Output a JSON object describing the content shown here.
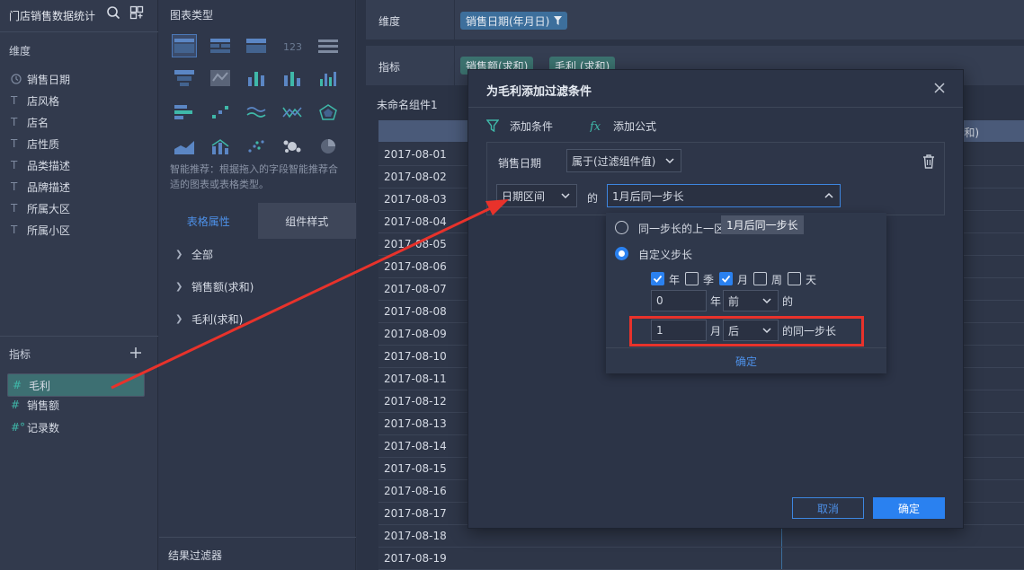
{
  "fields_panel": {
    "title": "门店销售数据统计",
    "dimensions_label": "维度",
    "dimensions": [
      {
        "type": "date",
        "label": "销售日期"
      },
      {
        "type": "T",
        "label": "店风格"
      },
      {
        "type": "T",
        "label": "店名"
      },
      {
        "type": "T",
        "label": "店性质"
      },
      {
        "type": "T",
        "label": "品类描述"
      },
      {
        "type": "T",
        "label": "品牌描述"
      },
      {
        "type": "T",
        "label": "所属大区"
      },
      {
        "type": "T",
        "label": "所属小区"
      }
    ],
    "measures_label": "指标",
    "measures": [
      {
        "type": "#",
        "label": "毛利",
        "selected": true
      },
      {
        "type": "#",
        "label": "销售额",
        "selected": false
      },
      {
        "type": "#°",
        "label": "记录数",
        "selected": false
      }
    ]
  },
  "chart_panel": {
    "title": "图表类型",
    "hint": "智能推荐：根据拖入的字段智能推荐合适的图表或表格类型。",
    "tabs": [
      "表格属性",
      "组件样式"
    ],
    "active_tab": 1,
    "tree": [
      "全部",
      "销售额(求和)",
      "毛利(求和)"
    ],
    "result_filter": "结果过滤器"
  },
  "main": {
    "dimension_label": "维度",
    "dimension_pill": "销售日期(年月日)",
    "measure_label": "指标",
    "measure_pills": [
      "销售额(求和)",
      "毛利 (求和)"
    ],
    "component_name": "未命名组件1",
    "header_right": "和)",
    "dates": [
      "2017-08-01",
      "2017-08-02",
      "2017-08-03",
      "2017-08-04",
      "2017-08-05",
      "2017-08-06",
      "2017-08-07",
      "2017-08-08",
      "2017-08-09",
      "2017-08-10",
      "2017-08-11",
      "2017-08-12",
      "2017-08-13",
      "2017-08-14",
      "2017-08-15",
      "2017-08-16",
      "2017-08-17",
      "2017-08-18",
      "2017-08-19"
    ]
  },
  "dialog": {
    "title": "为毛利添加过滤条件",
    "add_condition": "添加条件",
    "add_formula": "添加公式",
    "field": "销售日期",
    "operator": "属于(过滤组件值)",
    "date_type": "日期区间",
    "of": "的",
    "value": "1月后同一步长",
    "cancel": "取消",
    "ok": "确定"
  },
  "popover": {
    "opt_same": "同一步长的上一区",
    "tooltip": "1月后同一步长",
    "opt_custom": "自定义步长",
    "units": [
      {
        "label": "年",
        "checked": true
      },
      {
        "label": "季",
        "checked": false
      },
      {
        "label": "月",
        "checked": true
      },
      {
        "label": "周",
        "checked": false
      },
      {
        "label": "天",
        "checked": false
      }
    ],
    "row1": {
      "value": "0",
      "unit": "年",
      "dir": "前",
      "suffix": "的"
    },
    "row2": {
      "value": "1",
      "unit": "月",
      "dir": "后",
      "suffix": "的同一步长"
    },
    "confirm": "确定"
  },
  "colors": {
    "accent": "#2a81f0",
    "annotation": "#e8322b",
    "measure": "#3fb8a9"
  }
}
